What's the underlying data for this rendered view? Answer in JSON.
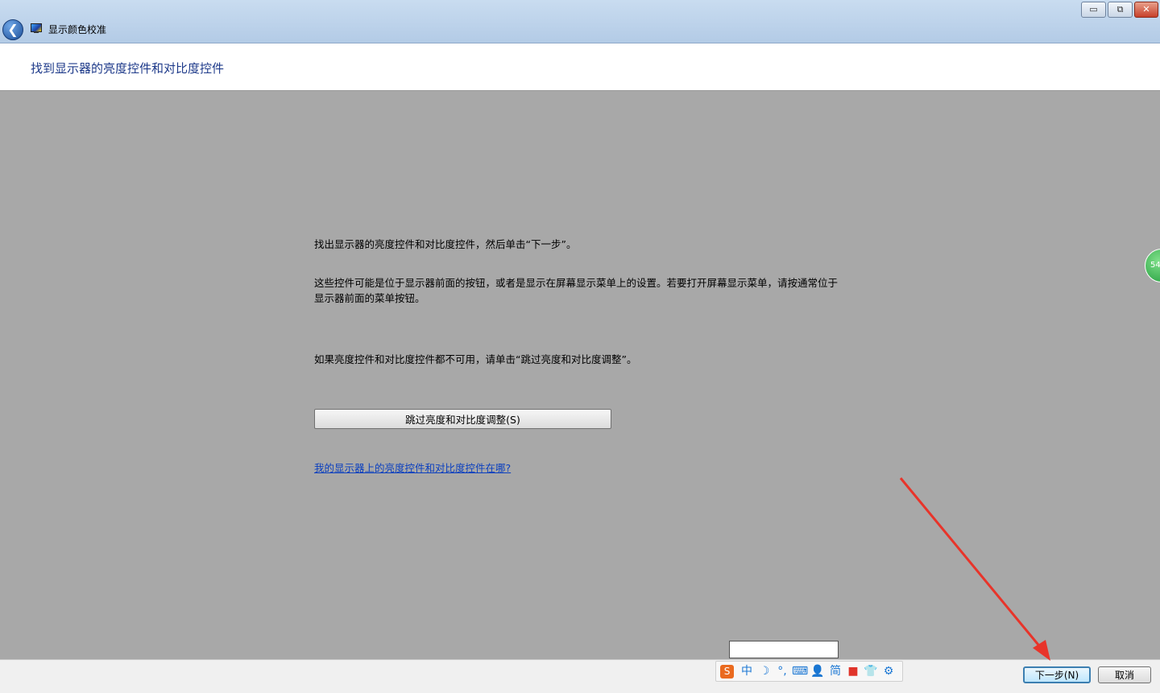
{
  "window": {
    "title": "显示颜色校准",
    "controls": {
      "minimize": "▭",
      "restore": "⧉",
      "close": "✕"
    }
  },
  "header": {
    "title": "找到显示器的亮度控件和对比度控件"
  },
  "body": {
    "instruction_1": "找出显示器的亮度控件和对比度控件，然后单击“下一步”。",
    "instruction_2": "这些控件可能是位于显示器前面的按钮，或者是显示在屏幕显示菜单上的设置。若要打开屏幕显示菜单，请按通常位于显示器前面的菜单按钮。",
    "instruction_3": "如果亮度控件和对比度控件都不可用，请单击“跳过亮度和对比度调整”。",
    "skip_button": "跳过亮度和对比度调整(S)",
    "help_link": "我的显示器上的亮度控件和对比度控件在哪?"
  },
  "badge": {
    "value": "54"
  },
  "ime_toolbar": {
    "items": [
      {
        "icon": "sogou-logo-icon",
        "glyph": "S"
      },
      {
        "icon": "chinese-mode-icon",
        "glyph": "中"
      },
      {
        "icon": "moon-icon",
        "glyph": "☽"
      },
      {
        "icon": "punctuation-icon",
        "glyph": "°,"
      },
      {
        "icon": "keyboard-icon",
        "glyph": "⌨"
      },
      {
        "icon": "user-icon",
        "glyph": "👤"
      },
      {
        "icon": "simplified-icon",
        "glyph": "简"
      },
      {
        "icon": "video-icon",
        "glyph": "■"
      },
      {
        "icon": "skin-icon",
        "glyph": "👕"
      },
      {
        "icon": "settings-gear-icon",
        "glyph": "⚙"
      }
    ]
  },
  "footer": {
    "next_button": "下一步(N)",
    "cancel_button": "取消"
  },
  "colors": {
    "arrow": "#e8342a",
    "background": "#a8a8a8",
    "title_link": "#1e3a8a"
  }
}
